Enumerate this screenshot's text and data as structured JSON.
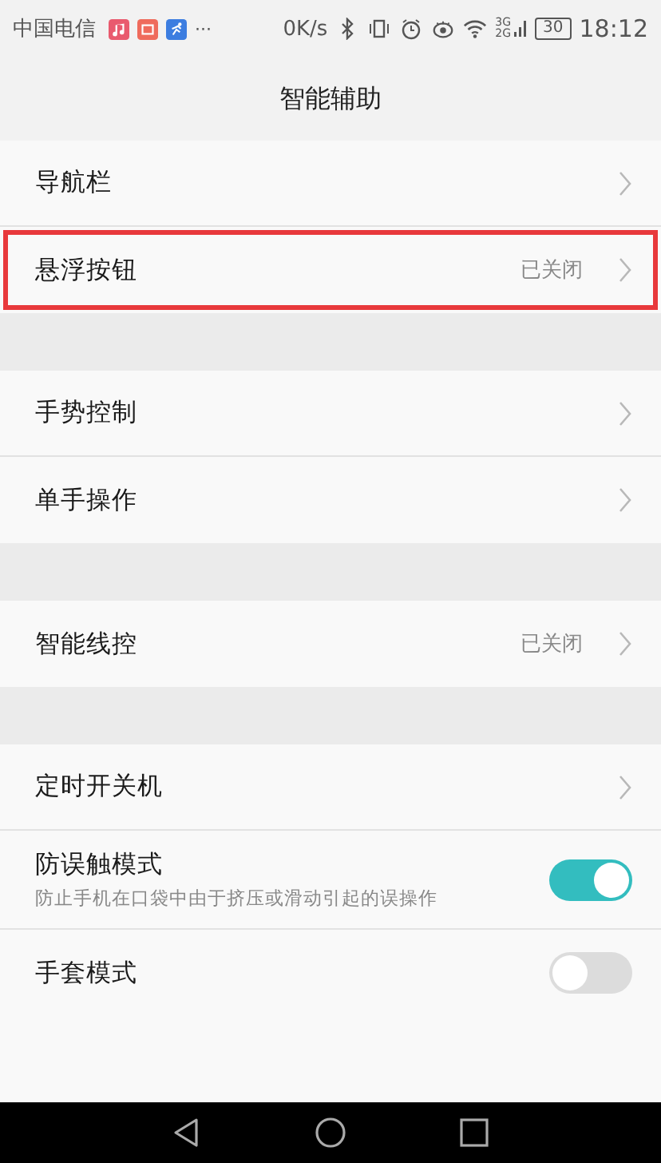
{
  "status_bar": {
    "carrier": "中国电信",
    "more": "···",
    "speed": "0K/s",
    "network": [
      "3G",
      "2G"
    ],
    "battery": "30",
    "time": "18:12"
  },
  "title": "智能辅助",
  "groups": [
    {
      "items": [
        {
          "kind": "link",
          "label": "导航栏",
          "highlighted": false
        },
        {
          "kind": "link",
          "label": "悬浮按钮",
          "value": "已关闭",
          "highlighted": true
        }
      ]
    },
    {
      "items": [
        {
          "kind": "link",
          "label": "手势控制",
          "highlighted": false
        },
        {
          "kind": "link",
          "label": "单手操作",
          "highlighted": false
        }
      ]
    },
    {
      "items": [
        {
          "kind": "link",
          "label": "智能线控",
          "value": "已关闭",
          "highlighted": false
        }
      ]
    },
    {
      "items": [
        {
          "kind": "link",
          "label": "定时开关机",
          "highlighted": false
        },
        {
          "kind": "toggle",
          "label": "防误触模式",
          "description": "防止手机在口袋中由于挤压或滑动引起的误操作",
          "on": true,
          "highlighted": false
        },
        {
          "kind": "toggle",
          "label": "手套模式",
          "on": false,
          "highlighted": false
        }
      ]
    }
  ]
}
